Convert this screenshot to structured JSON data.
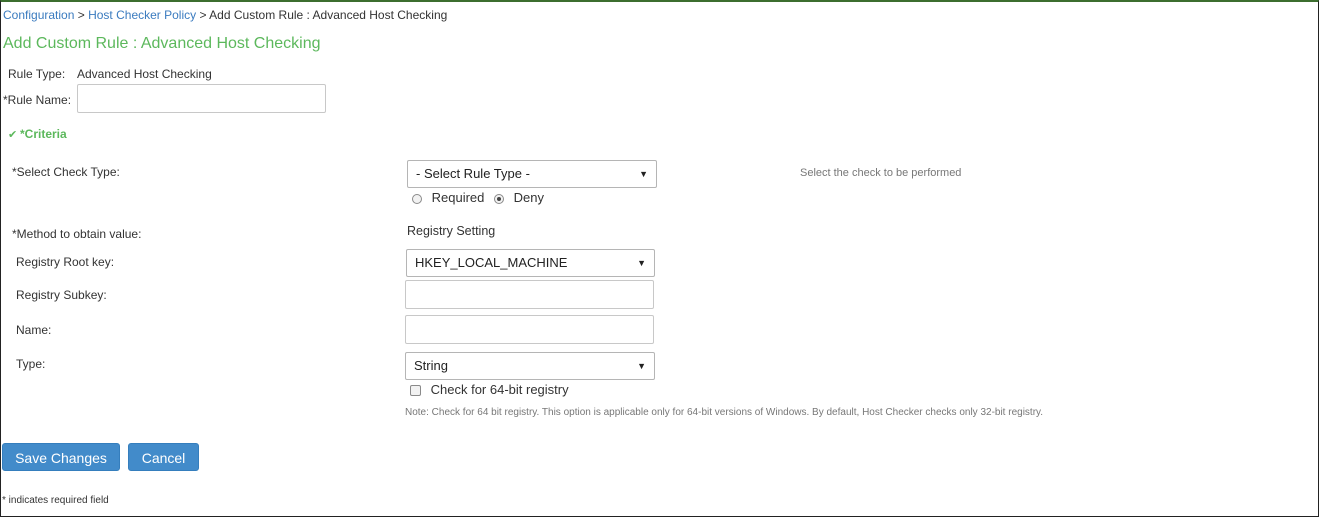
{
  "breadcrumb": {
    "items": [
      "Configuration",
      "Host Checker Policy"
    ],
    "separator": ">",
    "current": "Add Custom Rule : Advanced Host Checking"
  },
  "page_title": "Add Custom Rule : Advanced Host Checking",
  "rule_type": {
    "label": "Rule Type:",
    "value": "Advanced Host Checking"
  },
  "rule_name": {
    "label": "*Rule Name:",
    "value": ""
  },
  "criteria": {
    "label": "*Criteria"
  },
  "check_type": {
    "label": "*Select Check Type:",
    "selected": "- Select Rule Type -",
    "hint": "Select the check to be performed",
    "radio_required": "Required",
    "radio_deny": "Deny",
    "radio_selected": "Deny"
  },
  "method": {
    "label": "*Method to obtain value:",
    "value": "Registry Setting"
  },
  "registry_root": {
    "label": "Registry Root key:",
    "selected": "HKEY_LOCAL_MACHINE"
  },
  "registry_subkey": {
    "label": "Registry Subkey:",
    "value": ""
  },
  "name": {
    "label": "Name:",
    "value": ""
  },
  "type": {
    "label": "Type:",
    "selected": "String"
  },
  "check64": {
    "label": "Check for 64-bit registry",
    "checked": false,
    "note": "Note: Check for 64 bit registry. This option is applicable only for 64-bit versions of Windows. By default, Host Checker checks only 32-bit registry."
  },
  "buttons": {
    "save": "Save Changes",
    "cancel": "Cancel"
  },
  "footer": {
    "required_note": "* indicates required field"
  },
  "colors": {
    "title_green": "#5cb85c",
    "link_blue": "#3a7bbf",
    "button_blue": "#428bca"
  },
  "icons": {
    "criteria": "chevron-down-icon",
    "select_caret": "caret-down-icon"
  }
}
